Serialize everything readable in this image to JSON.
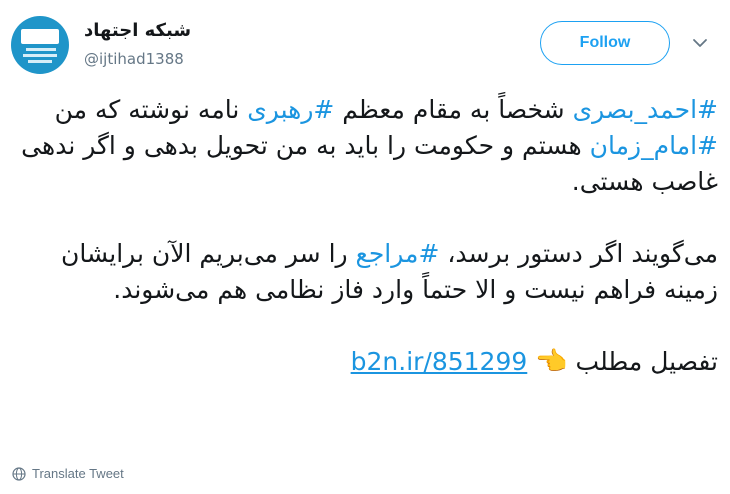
{
  "author": {
    "display_name": "شبکه اجتهاد",
    "handle": "@ijtihad1388",
    "avatar_icon": "ijtihad-logo"
  },
  "follow_label": "Follow",
  "caret_icon": "chevron-down-icon",
  "tweet": {
    "p1_tag1": "#احمد_بصری",
    "p1_text1": " شخصاً به مقام معظم ",
    "p1_tag2": "#رهبری",
    "p1_text2": " نامه نوشته که من ",
    "p1_tag3": "#امام_زمان",
    "p1_text3": " هستم و حکومت را باید به من تحویل بدهی و اگر ندهی غاصب هستی.",
    "p2_text1": "می‌گویند اگر دستور برسد، ",
    "p2_tag1": "#مراجع",
    "p2_text2": " را سر می‌بریم الآن برایشان زمینه فراهم نیست و الا حتماً وارد فاز نظامی هم می‌شوند.",
    "link_prefix": "تفصیل مطلب ",
    "pointer_emoji": "👈",
    "link_text": "b2n.ir/851299"
  },
  "translate_label": "Translate Tweet",
  "colors": {
    "accent": "#1da1f2",
    "link": "#1b95e0",
    "muted": "#657786"
  }
}
